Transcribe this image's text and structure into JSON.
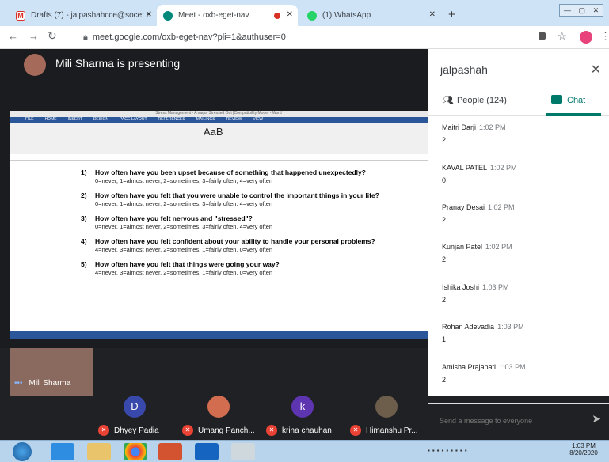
{
  "tabs": [
    {
      "title": "Drafts (7) - jalpashahcce@socet.e",
      "active": false
    },
    {
      "title": "Meet - oxb-eget-nav",
      "active": true
    },
    {
      "title": "(1) WhatsApp",
      "active": false
    }
  ],
  "new_tab": "+",
  "address": "meet.google.com/oxb-eget-nav?pli=1&authuser=0",
  "presenter": {
    "name": "Mili Sharma",
    "banner": "Mili Sharma is presenting"
  },
  "word": {
    "title": "Stress Management - A major Stressed Out [Compatibility Mode] - Word",
    "menu": [
      "FILE",
      "HOME",
      "INSERT",
      "DESIGN",
      "PAGE LAYOUT",
      "REFERENCES",
      "MAILINGS",
      "REVIEW",
      "VIEW"
    ],
    "style_sample": "AaB",
    "questions": [
      {
        "n": "1)",
        "text": "How often have you been upset because of something that happened unexpectedly?",
        "scale": "0=never, 1=almost never, 2=sometimes, 3=fairly often, 4=very often"
      },
      {
        "n": "2)",
        "text": "How often have you felt that you were unable to control the important things in your life?",
        "scale": "0=never, 1=almost never, 2=sometimes, 3=fairly often, 4=very often"
      },
      {
        "n": "3)",
        "text": "How often have you felt nervous and \"stressed\"?",
        "scale": "0=never, 1=almost never, 2=sometimes, 3=fairly often, 4=very often"
      },
      {
        "n": "4)",
        "text": "How often have you felt confident about your ability to handle your personal problems?",
        "scale": "4=never, 3=almost never, 2=sometimes, 1=fairly often, 0=very often"
      },
      {
        "n": "5)",
        "text": "How often have you felt that things were going your way?",
        "scale": "4=never, 3=almost never, 2=sometimes, 1=fairly often, 0=very often"
      }
    ]
  },
  "participants": [
    {
      "name": "Mili Sharma",
      "initial": "",
      "muted": false
    },
    {
      "name": "Dhyey Padia",
      "initial": "D",
      "muted": true
    },
    {
      "name": "Umang Panch...",
      "initial": "",
      "muted": true
    },
    {
      "name": "krina chauhan",
      "initial": "k",
      "muted": true
    },
    {
      "name": "Himanshu Pr...",
      "initial": "",
      "muted": true
    }
  ],
  "more_options": "•••",
  "panel": {
    "title": "jalpashah",
    "people_label": "People (124)",
    "chat_label": "Chat",
    "messages": [
      {
        "who": "Maitri Darji",
        "time": "1:02 PM",
        "text": "2"
      },
      {
        "who": "KAVAL PATEL",
        "time": "1:02 PM",
        "text": "0"
      },
      {
        "who": "Pranay Desai",
        "time": "1:02 PM",
        "text": "2"
      },
      {
        "who": "Kunjan Patel",
        "time": "1:02 PM",
        "text": "2"
      },
      {
        "who": "Ishika Joshi",
        "time": "1:03 PM",
        "text": "2"
      },
      {
        "who": "Rohan Adevadia",
        "time": "1:03 PM",
        "text": "1"
      },
      {
        "who": "Amisha Prajapati",
        "time": "1:03 PM",
        "text": "2"
      }
    ],
    "input_placeholder": "Send a message to everyone"
  },
  "clock": {
    "time": "1:03 PM",
    "date": "8/20/2020"
  },
  "colors": {
    "accent": "#00796b",
    "mic_off": "#ea4335",
    "word_blue": "#2b579a"
  }
}
